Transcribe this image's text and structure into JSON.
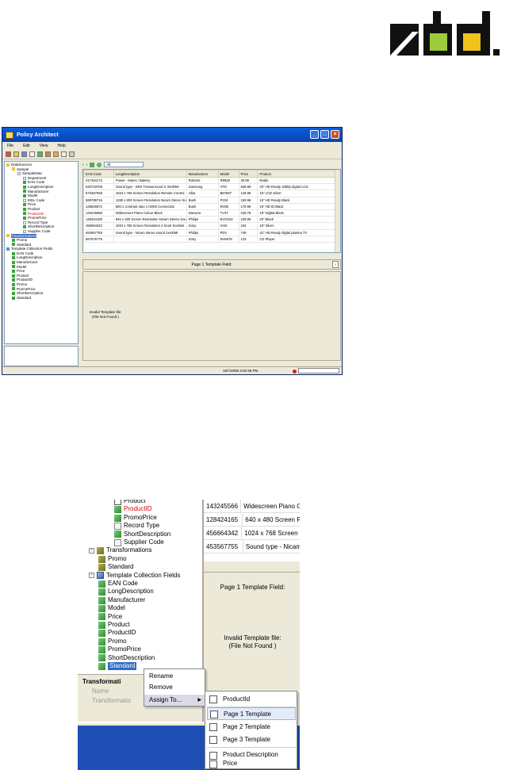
{
  "app": {
    "title": "Policy Architect",
    "menu": [
      "File",
      "Edit",
      "View",
      "Help"
    ],
    "combo_value": "All"
  },
  "tree": {
    "items": [
      {
        "label": "DataSources",
        "style": ""
      },
      {
        "label": "Sample",
        "style": ""
      },
      {
        "label": "SampleData",
        "style": ""
      },
      {
        "label": "Department",
        "style": ""
      },
      {
        "label": "EAN Code",
        "style": ""
      },
      {
        "label": "LongDescription",
        "style": ""
      },
      {
        "label": "Manufacturer",
        "style": ""
      },
      {
        "label": "Model",
        "style": ""
      },
      {
        "label": "MSL Code",
        "style": ""
      },
      {
        "label": "Price",
        "style": ""
      },
      {
        "label": "Product",
        "style": ""
      },
      {
        "label": "ProductID",
        "style": "red"
      },
      {
        "label": "PromoPrice",
        "style": ""
      },
      {
        "label": "Record Type",
        "style": ""
      },
      {
        "label": "ShortDescription",
        "style": ""
      },
      {
        "label": "Supplier Code",
        "style": ""
      },
      {
        "label": "Transformations",
        "style": "sel"
      },
      {
        "label": "Promo",
        "style": ""
      },
      {
        "label": "Standard",
        "style": ""
      },
      {
        "label": "Template Collection Fields",
        "style": ""
      },
      {
        "label": "EAN Code",
        "style": ""
      },
      {
        "label": "LongDescription",
        "style": ""
      },
      {
        "label": "Manufacturer",
        "style": ""
      },
      {
        "label": "Model",
        "style": ""
      },
      {
        "label": "Price",
        "style": ""
      },
      {
        "label": "Product",
        "style": ""
      },
      {
        "label": "ProductID",
        "style": ""
      },
      {
        "label": "Promo",
        "style": ""
      },
      {
        "label": "PromoPrice",
        "style": ""
      },
      {
        "label": "ShortDescription",
        "style": ""
      },
      {
        "label": "Standard",
        "style": ""
      }
    ]
  },
  "grid": {
    "headers": [
      "EAN Code",
      "LongDescription",
      "Manufacturer",
      "Model",
      "Price",
      "Product"
    ],
    "rows": [
      [
        "417264173",
        "Power - Mains / Battery",
        "Roberts",
        "R9928",
        "39.99",
        "Radio"
      ],
      [
        "520733708",
        "Sound type - SRS Truesurround X 3xHDMI",
        "Samsung",
        "VTD",
        "849.99",
        "40\" HD Ready 1080p digital LCD"
      ],
      [
        "673467838",
        "1024 x 768 Screen Resolution Remote Control",
        "Alba",
        "B67587",
        "129.99",
        "15\" LCD Silver"
      ],
      [
        "589789716",
        "1280 x 800 Screen Resolution Nicam Stereo Sound",
        "Bush",
        "P234",
        "159.99",
        "15\" HD Ready Black"
      ],
      [
        "128626972",
        "500:1 Contrast ratio 1 HDMI Connection",
        "Bush",
        "RV85",
        "179.99",
        "19\" HD ID Black"
      ],
      [
        "143245566",
        "Widescreen Piano Colour Black",
        "Daewoo",
        "TV37",
        "229.79",
        "19\" Digital Black"
      ],
      [
        "128424165",
        "640 x 480 Screen Resolution Nicam Stereo Sound",
        "Philips",
        "EVO243",
        "239.99",
        "20\" Black"
      ],
      [
        "456664342",
        "1024 x 768 Screen Resolution 2 Scart Sockets",
        "Sony",
        "VAI0",
        "242",
        "15\" Silver"
      ],
      [
        "453567755",
        "Sound type - Nicam stereo sound 2xHDMI",
        "Philips",
        "PDV",
        "749",
        "42\" HD Ready digital plasma TV"
      ],
      [
        "567676776",
        "",
        "Sony",
        "SH5678",
        "123",
        "CD Player"
      ]
    ]
  },
  "preview": {
    "header": "Page 1 Template Field:",
    "message_line1": "Invalid Template file:",
    "message_line2": "(File Not Found )"
  },
  "status": {
    "timestamp": "18/7/2009 3:40:35 PM"
  },
  "zoom": {
    "tree": [
      {
        "label": "Product",
        "cls": "",
        "ic": "fld",
        "x": 46
      },
      {
        "label": "ProductID",
        "cls": "red",
        "ic": "g",
        "x": 46
      },
      {
        "label": "PromoPrice",
        "cls": "",
        "ic": "g",
        "x": 46
      },
      {
        "label": "Record Type",
        "cls": "",
        "ic": "s",
        "x": 46
      },
      {
        "label": "ShortDescription",
        "cls": "",
        "ic": "g",
        "x": 46
      },
      {
        "label": "Supplier Code",
        "cls": "",
        "ic": "s",
        "x": 46
      },
      {
        "label": "Transformations",
        "cls": "",
        "ic": "tr",
        "x": 14
      },
      {
        "label": "Promo",
        "cls": "",
        "ic": "tr",
        "x": 26
      },
      {
        "label": "Standard",
        "cls": "",
        "ic": "tr",
        "x": 26
      },
      {
        "label": "Template Collection Fields",
        "cls": "",
        "ic": "t",
        "x": 14
      },
      {
        "label": "EAN Code",
        "cls": "",
        "ic": "g",
        "x": 26
      },
      {
        "label": "LongDescription",
        "cls": "",
        "ic": "g",
        "x": 26
      },
      {
        "label": "Manufacturer",
        "cls": "",
        "ic": "g",
        "x": 26
      },
      {
        "label": "Model",
        "cls": "",
        "ic": "g",
        "x": 26
      },
      {
        "label": "Price",
        "cls": "",
        "ic": "g",
        "x": 26
      },
      {
        "label": "Product",
        "cls": "",
        "ic": "g",
        "x": 26
      },
      {
        "label": "ProductID",
        "cls": "",
        "ic": "g",
        "x": 26
      },
      {
        "label": "Promo",
        "cls": "",
        "ic": "g",
        "x": 26
      },
      {
        "label": "PromoPrice",
        "cls": "",
        "ic": "g",
        "x": 26
      },
      {
        "label": "ShortDescription",
        "cls": "",
        "ic": "g",
        "x": 26
      },
      {
        "label": "Standard",
        "cls": "sel",
        "ic": "g",
        "x": 26
      }
    ],
    "grid": [
      [
        "143245566",
        "Widescreen Piano C"
      ],
      [
        "128424165",
        "640 x 480 Screen R"
      ],
      [
        "456664342",
        "1024 x 768 Screen I"
      ],
      [
        "453567755",
        "Sound type - Nicam"
      ]
    ],
    "panel_header": "Page 1 Template Field:",
    "panel_msg1": "Invalid Template file:",
    "panel_msg2": "(File Not Found )",
    "props_title": "Transformati",
    "props_name": "Name",
    "props_value": "Transformatio"
  },
  "context_menu": {
    "rename": "Rename",
    "remove": "Remove",
    "assign": "Assign To..."
  },
  "submenu": {
    "items": [
      "ProductId",
      "Page 1 Template",
      "Page 2 Template",
      "Page 3 Template",
      "Product Description",
      "Price"
    ]
  }
}
